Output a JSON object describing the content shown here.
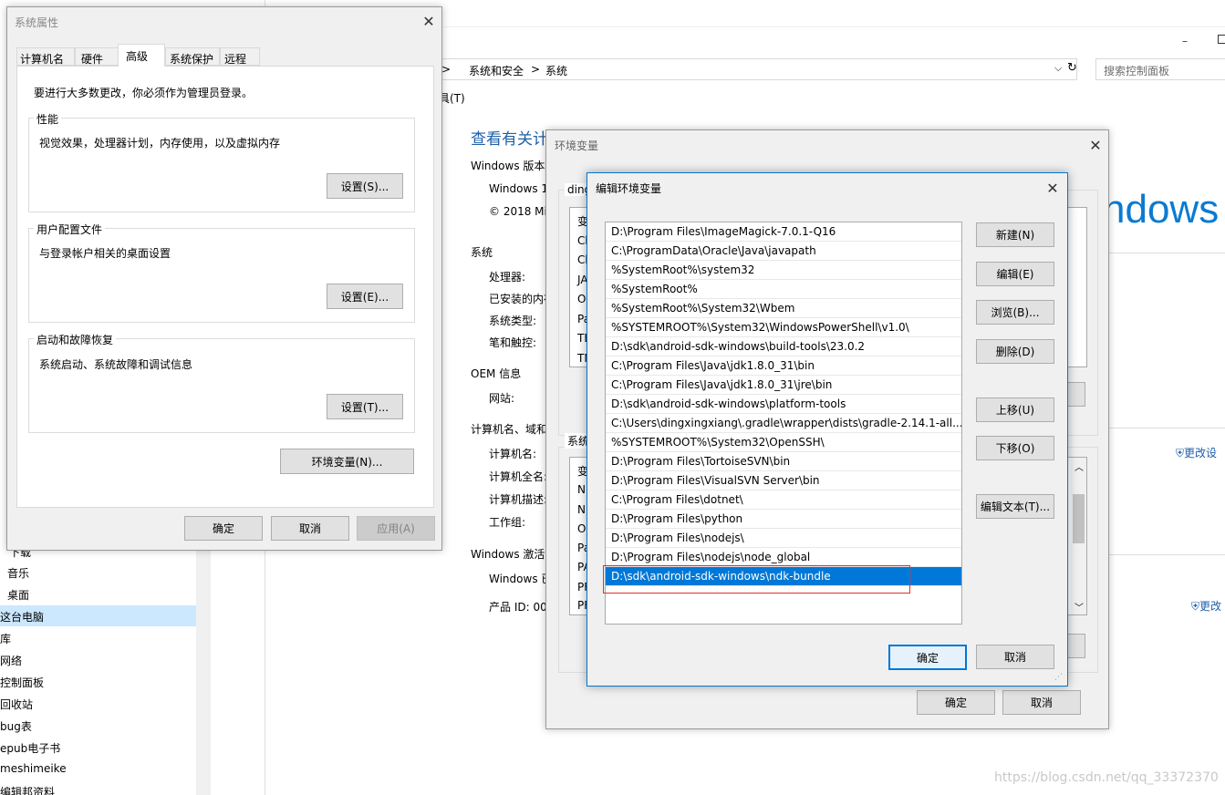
{
  "control_panel": {
    "breadcrumb_part1": "系统和安全",
    "breadcrumb_sep1": ">",
    "breadcrumb_sep0": ">",
    "breadcrumb_part2": "系统",
    "search_placeholder": "搜索控制面板",
    "menu_fragment": "具(T)",
    "heading": "查看有关计算机的基本信息",
    "windows_version_label": "Windows 版本",
    "windows_edition": "Windows 1",
    "copyright": "© 2018 Mi",
    "windows_logo_text": "ndows",
    "system_label": "系统",
    "processor_label": "处理器:",
    "ram_label": "已安装的内存",
    "system_type_label": "系统类型:",
    "pen_touch_label": "笔和触控:",
    "oem_label": "OEM 信息",
    "website_label": "网站:",
    "computer_section_label": "计算机名、域和",
    "computer_name_label": "计算机名:",
    "full_name_label": "计算机全名:",
    "description_label": "计算机描述:",
    "workgroup_label": "工作组:",
    "activation_label": "Windows 激活",
    "windows_activated": "Windows 已",
    "product_id_label": "产品 ID: 00",
    "change_settings_1": "更改设",
    "change_settings_2": "更改"
  },
  "left_nav": {
    "items": [
      "下载",
      "音乐",
      "桌面",
      "这台电脑",
      "库",
      "网络",
      "控制面板",
      "回收站",
      "bug表",
      "epub电子书",
      "meshimeike",
      "编辑邦资料"
    ]
  },
  "sys_props": {
    "title": "系统属性",
    "tabs": [
      "计算机名",
      "硬件",
      "高级",
      "系统保护",
      "远程"
    ],
    "admin_notice": "要进行大多数更改，你必须作为管理员登录。",
    "perf_title": "性能",
    "perf_desc": "视觉效果，处理器计划，内存使用，以及虚拟内存",
    "perf_button": "设置(S)...",
    "profile_title": "用户配置文件",
    "profile_desc": "与登录帐户相关的桌面设置",
    "profile_button": "设置(E)...",
    "startup_title": "启动和故障恢复",
    "startup_desc": "系统启动、系统故障和调试信息",
    "startup_button": "设置(T)...",
    "env_button": "环境变量(N)...",
    "ok": "确定",
    "cancel": "取消",
    "apply": "应用(A)"
  },
  "env_vars": {
    "title": "环境变量",
    "user_group_fragment": "ding",
    "user_col_fragment": "变",
    "user_rows": [
      "Ch",
      "Ch",
      "JA",
      "O",
      "Pa",
      "TE",
      "TN"
    ],
    "sys_group_fragment": "系统",
    "sys_col_fragment": "变",
    "sys_rows": [
      "N",
      "N",
      "O",
      "Pa",
      "PA",
      "PF",
      "PF"
    ],
    "ok": "确定",
    "cancel": "取消"
  },
  "edit_env": {
    "title": "编辑环境变量",
    "paths": [
      "D:\\Program Files\\ImageMagick-7.0.1-Q16",
      "C:\\ProgramData\\Oracle\\Java\\javapath",
      "%SystemRoot%\\system32",
      "%SystemRoot%",
      "%SystemRoot%\\System32\\Wbem",
      "%SYSTEMROOT%\\System32\\WindowsPowerShell\\v1.0\\",
      "D:\\sdk\\android-sdk-windows\\build-tools\\23.0.2",
      "C:\\Program Files\\Java\\jdk1.8.0_31\\bin",
      "C:\\Program Files\\Java\\jdk1.8.0_31\\jre\\bin",
      "D:\\sdk\\android-sdk-windows\\platform-tools",
      "C:\\Users\\dingxingxiang\\.gradle\\wrapper\\dists\\gradle-2.14.1-all...",
      "%SYSTEMROOT%\\System32\\OpenSSH\\",
      "D:\\Program Files\\TortoiseSVN\\bin",
      "D:\\Program Files\\VisualSVN Server\\bin",
      "C:\\Program Files\\dotnet\\",
      "D:\\Program Files\\python",
      "D:\\Program Files\\nodejs\\",
      "D:\\Program Files\\nodejs\\node_global",
      "D:\\sdk\\android-sdk-windows\\ndk-bundle"
    ],
    "new_button": "新建(N)",
    "edit_button": "编辑(E)",
    "browse_button": "浏览(B)...",
    "delete_button": "删除(D)",
    "move_up_button": "上移(U)",
    "move_down_button": "下移(O)",
    "edit_text_button": "编辑文本(T)...",
    "ok": "确定",
    "cancel": "取消"
  },
  "watermark": "https://blog.csdn.net/qq_33372370"
}
